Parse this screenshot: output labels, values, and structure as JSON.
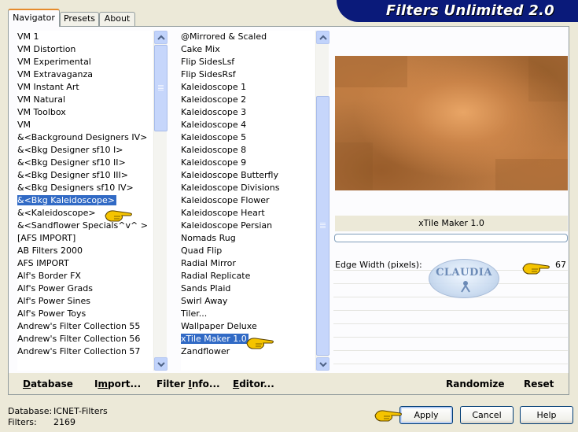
{
  "title": "Filters Unlimited 2.0",
  "tabs": [
    "Navigator",
    "Presets",
    "About"
  ],
  "category_list": [
    "VM 1",
    "VM Distortion",
    "VM Experimental",
    "VM Extravaganza",
    "VM Instant Art",
    "VM Natural",
    "VM Toolbox",
    "VM",
    "&<Background Designers IV>",
    "&<Bkg Designer sf10 I>",
    "&<Bkg Designer sf10 II>",
    "&<Bkg Designer sf10 III>",
    "&<Bkg Designers sf10 IV>",
    "&<Bkg Kaleidoscope>",
    "&<Kaleidoscope>",
    "&<Sandflower Specials^v^ >",
    "[AFS IMPORT]",
    "AB Filters 2000",
    "AFS IMPORT",
    "Alf's Border FX",
    "Alf's Power Grads",
    "Alf's Power Sines",
    "Alf's Power Toys",
    "Andrew's Filter Collection 55",
    "Andrew's Filter Collection 56",
    "Andrew's Filter Collection 57"
  ],
  "filter_list": [
    "@Mirrored & Scaled",
    "Cake Mix",
    "Flip SidesLsf",
    "Flip SidesRsf",
    "Kaleidoscope 1",
    "Kaleidoscope 2",
    "Kaleidoscope 3",
    "Kaleidoscope 4",
    "Kaleidoscope 5",
    "Kaleidoscope 8",
    "Kaleidoscope 9",
    "Kaleidoscope Butterfly",
    "Kaleidoscope Divisions",
    "Kaleidoscope Flower",
    "Kaleidoscope Heart",
    "Kaleidoscope Persian",
    "Nomads Rug",
    "Quad Flip",
    "Radial Mirror",
    "Radial Replicate",
    "Sands Plaid",
    "Swirl Away",
    "Tiler...",
    "Wallpaper Deluxe",
    "xTile Maker 1.0",
    "Zandflower"
  ],
  "selected_category_index": 13,
  "selected_filter_index": 24,
  "current_filter_name": "xTile Maker 1.0",
  "param": {
    "label": "Edge Width (pixels):",
    "value": "67"
  },
  "watermark": "CLAUDIA",
  "bottom_links": {
    "database": {
      "hot": "D",
      "rest": "atabase"
    },
    "import": {
      "pre": "I",
      "hot": "m",
      "rest": "port..."
    },
    "filter_info": {
      "pre": "Filter ",
      "hot": "I",
      "rest": "nfo..."
    },
    "editor": {
      "hot": "E",
      "rest": "ditor..."
    },
    "randomize": "Randomize",
    "reset": "Reset"
  },
  "status": {
    "database_label": "Database:",
    "database_value": "ICNET-Filters",
    "filters_label": "Filters:",
    "filters_value": "2169"
  },
  "buttons": {
    "apply": "Apply",
    "cancel": "Cancel",
    "help": "Help"
  },
  "colors": {
    "title_banner": "#0a1a7a",
    "selection": "#316ac5",
    "dialog_bg": "#ece9d8",
    "pointer_hand": "#f5c400"
  }
}
